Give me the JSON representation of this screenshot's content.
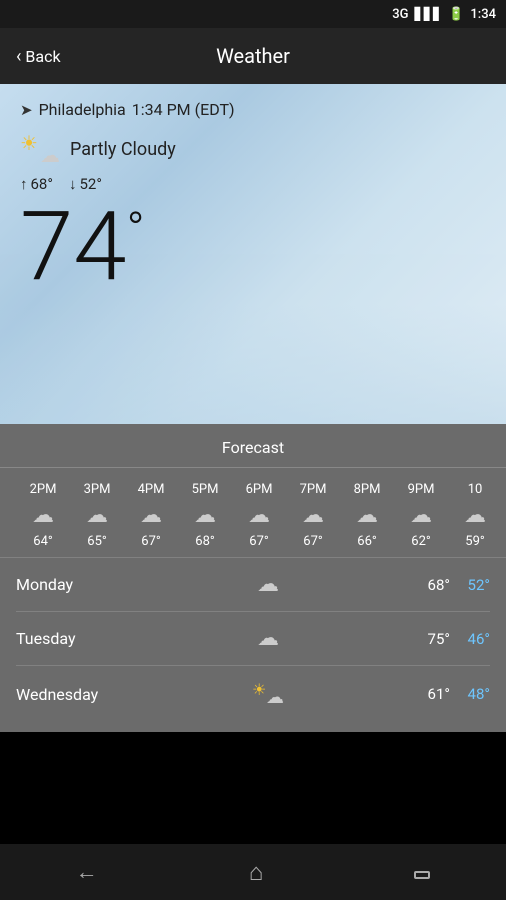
{
  "statusBar": {
    "signal": "3G",
    "battery": "🔋",
    "time": "1:34"
  },
  "navBar": {
    "backLabel": "Back",
    "title": "Weather"
  },
  "hero": {
    "locationArrow": "➤",
    "location": "Philadelphia",
    "time": "1:34 PM (EDT)",
    "condition": "Partly Cloudy",
    "highLabel": "68°",
    "lowLabel": "52°",
    "currentTemp": "74",
    "degreeSymbol": "°"
  },
  "forecast": {
    "title": "Forecast",
    "hourly": [
      {
        "time": "2PM",
        "temp": "64°"
      },
      {
        "time": "3PM",
        "temp": "65°"
      },
      {
        "time": "4PM",
        "temp": "67°"
      },
      {
        "time": "5PM",
        "temp": "68°"
      },
      {
        "time": "6PM",
        "temp": "67°"
      },
      {
        "time": "7PM",
        "temp": "67°"
      },
      {
        "time": "8PM",
        "temp": "66°"
      },
      {
        "time": "9PM",
        "temp": "62°"
      },
      {
        "time": "10",
        "temp": "59°"
      }
    ],
    "daily": [
      {
        "day": "Monday",
        "hi": "68°",
        "lo": "52°",
        "icon": "cloud"
      },
      {
        "day": "Tuesday",
        "hi": "75°",
        "lo": "46°",
        "icon": "cloud"
      },
      {
        "day": "Wednesday",
        "hi": "61°",
        "lo": "48°",
        "icon": "partly"
      }
    ]
  },
  "bottomNav": {
    "backArrow": "←",
    "homeShape": "⌂",
    "recentSquare": "▭"
  }
}
